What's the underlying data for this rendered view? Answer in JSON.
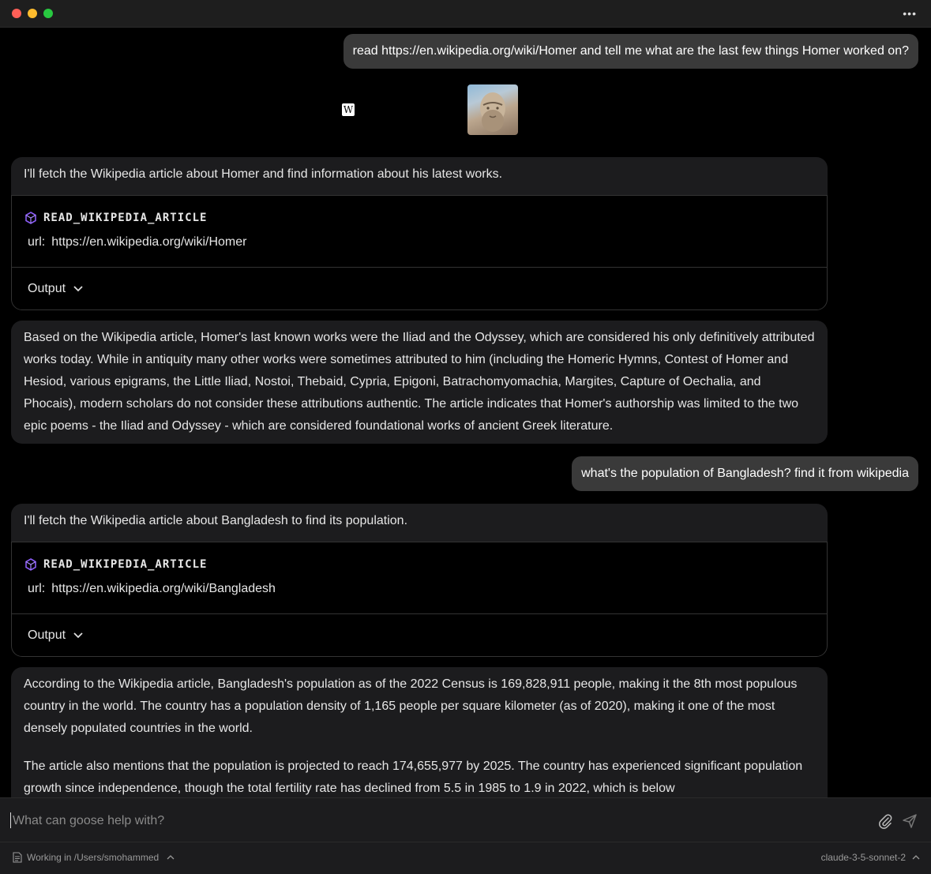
{
  "window": {
    "more_label": "•••"
  },
  "messages": {
    "user1": "read https://en.wikipedia.org/wiki/Homer and tell me what are the last few things Homer worked on?",
    "preview": {
      "favicon_label": "W"
    },
    "assistant1_intro": "I'll fetch the Wikipedia article about Homer and find information about his latest works.",
    "tool1": {
      "name": "READ_WIKIPEDIA_ARTICLE",
      "url_key": "url:",
      "url_value": "https://en.wikipedia.org/wiki/Homer",
      "output_label": "Output"
    },
    "assistant1_answer": "Based on the Wikipedia article, Homer's last known works were the Iliad and the Odyssey, which are considered his only definitively attributed works today. While in antiquity many other works were sometimes attributed to him (including the Homeric Hymns, Contest of Homer and Hesiod, various epigrams, the Little Iliad, Nostoi, Thebaid, Cypria, Epigoni, Batrachomyomachia, Margites, Capture of Oechalia, and Phocais), modern scholars do not consider these attributions authentic. The article indicates that Homer's authorship was limited to the two epic poems - the Iliad and Odyssey - which are considered foundational works of ancient Greek literature.",
    "user2": "what's the population of Bangladesh? find it from wikipedia",
    "assistant2_intro": "I'll fetch the Wikipedia article about Bangladesh to find its population.",
    "tool2": {
      "name": "READ_WIKIPEDIA_ARTICLE",
      "url_key": "url:",
      "url_value": "https://en.wikipedia.org/wiki/Bangladesh",
      "output_label": "Output"
    },
    "assistant2_p1": "According to the Wikipedia article, Bangladesh's population as of the 2022 Census is 169,828,911 people, making it the 8th most populous country in the world. The country has a population density of 1,165 people per square kilometer (as of 2020), making it one of the most densely populated countries in the world.",
    "assistant2_p2": "The article also mentions that the population is projected to reach 174,655,977 by 2025. The country has experienced significant population growth since independence, though the total fertility rate has declined from 5.5 in 1985 to 1.9 in 2022, which is below"
  },
  "composer": {
    "placeholder": "What can goose help with?"
  },
  "status": {
    "working_dir": "Working in /Users/smohammed",
    "model": "claude-3-5-sonnet-2"
  },
  "colors": {
    "tool_icon": "#8b5cf6",
    "bubble_user": "#3a3a3a",
    "bubble_assistant": "#1c1c1e"
  }
}
